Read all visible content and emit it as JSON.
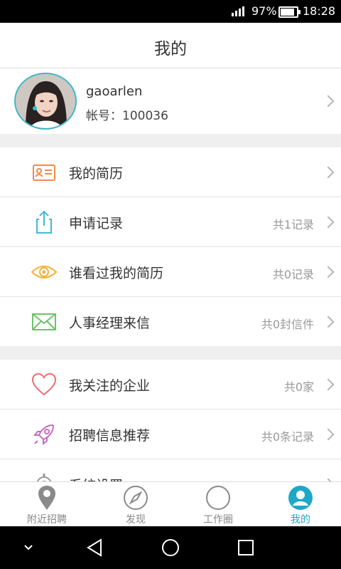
{
  "status_bar": {
    "battery_percent": "97%",
    "battery_level": 0.97,
    "time": "18:28"
  },
  "header": {
    "title": "我的"
  },
  "profile": {
    "username": "gaoarlen",
    "account": "帐号：100036"
  },
  "section1": [
    {
      "label": "我的简历",
      "count": "",
      "icon": "resume-card-icon"
    },
    {
      "label": "申请记录",
      "count": "共1记录",
      "icon": "share-upload-icon"
    },
    {
      "label": "谁看过我的简历",
      "count": "共0记录",
      "icon": "eye-icon"
    },
    {
      "label": "人事经理来信",
      "count": "共0封信件",
      "icon": "mail-envelope-icon"
    }
  ],
  "section2": [
    {
      "label": "我关注的企业",
      "count": "共0家",
      "icon": "heart-icon"
    },
    {
      "label": "招聘信息推荐",
      "count": "共0条记录",
      "icon": "rocket-icon"
    },
    {
      "label": "系统设置",
      "count": "",
      "icon": "gear-icon"
    }
  ],
  "tabs": [
    {
      "label": "附近招聘",
      "icon": "location-pin-icon"
    },
    {
      "label": "发现",
      "icon": "compass-icon"
    },
    {
      "label": "工作圈",
      "icon": "circle-icon"
    },
    {
      "label": "我的",
      "icon": "user-profile-icon"
    }
  ],
  "colors": {
    "accent": "#1da8c8",
    "tab_inactive": "#888888",
    "avatar_ring": "#39b7c8"
  }
}
